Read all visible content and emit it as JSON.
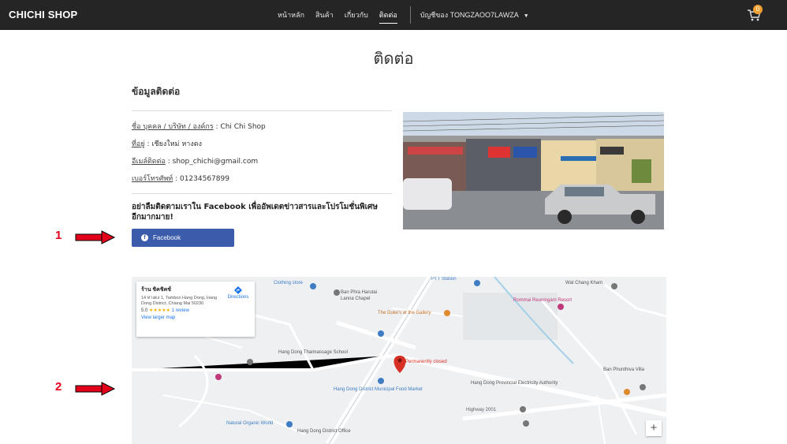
{
  "navbar": {
    "brand": "CHICHI SHOP",
    "links": [
      "หน้าหลัก",
      "สินค้า",
      "เกี่ยวกับ",
      "ติดต่อ"
    ],
    "active_index": 3,
    "account_label": "บัญชีของ TONGZAOO7LAWZA",
    "cart_count": "0"
  },
  "page": {
    "title": "ติดต่อ"
  },
  "contact": {
    "heading": "ข้อมูลติดต่อ",
    "rows": [
      {
        "label": "ชื่อ บุคคล / บริษัท / องค์กร",
        "value": " : Chi Chi Shop"
      },
      {
        "label": "ที่อยู่",
        "value": " : เชียงใหม่ หางดง"
      },
      {
        "label": "อีเมล์ติดต่อ",
        "value": " : shop_chichi@gmail.com"
      },
      {
        "label": "เบอร์โทรศัพท์",
        "value": " : 01234567899"
      }
    ],
    "follow_text": "อย่าลืมติดตามเราใน Facebook เพื่ออัพเดตข่าวสารและโปรโมชั่นพิเศษอีกมากมาย!",
    "facebook_button": "Facebook"
  },
  "annotations": [
    "1",
    "2"
  ],
  "map": {
    "card": {
      "name": "ร้าน ชิคชิคช์",
      "address": "14 หางดง 1, Tambon Hang Dong, Hang Dong District, Chiang Mai 50230",
      "rating": "5.0",
      "stars": "★★★★★",
      "reviews": "1 review",
      "view_larger": "View larger map",
      "directions": "Directions"
    },
    "labels": [
      {
        "text": "Ban Phra Harutai",
        "cls": ""
      },
      {
        "text": "Lanna Chapel",
        "cls": ""
      },
      {
        "text": "PTT Station",
        "cls": "blue"
      },
      {
        "text": "Wat Chang Kham",
        "cls": ""
      },
      {
        "text": "Rommai Reuningam Resort",
        "cls": "pink"
      },
      {
        "text": "The Duke's at the Gallery",
        "cls": "orange"
      },
      {
        "text": "Permanently closed",
        "cls": "red"
      },
      {
        "text": "Hang Dong Thaimassage School",
        "cls": ""
      },
      {
        "text": "Hang Dong District Municipal Food Market",
        "cls": "blue"
      },
      {
        "text": "Hang Dong Provincial Electricity Authority",
        "cls": ""
      },
      {
        "text": "Ban Phunthiva Villa",
        "cls": ""
      },
      {
        "text": "Highway 2001",
        "cls": "road"
      },
      {
        "text": "Natural Organic World",
        "cls": "blue"
      },
      {
        "text": "Hang Dong District Office",
        "cls": ""
      },
      {
        "text": "Clothing store",
        "cls": "blue"
      }
    ],
    "zoom_in": "+"
  }
}
